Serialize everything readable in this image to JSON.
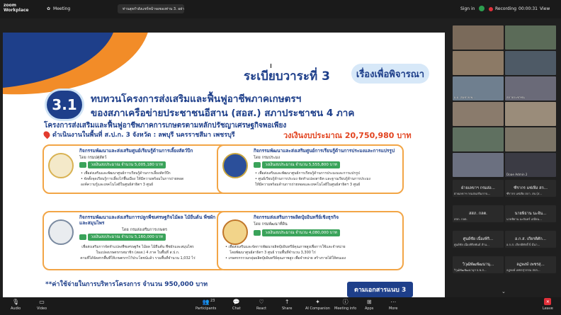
{
  "app": {
    "brand_line1": "zoom",
    "brand_line2": "Workplace",
    "meeting_label": "Meeting",
    "share_label": "ท่านสุดกำลังแชร์หน้าจอของท่าน 3. อย่า...",
    "sign_in": "Sign in",
    "recording": "Recording",
    "timer": "00:00:31",
    "view": "View"
  },
  "slide": {
    "agenda": "ระเบียบวาระที่ 3",
    "agenda_tag": "เรื่องเพื่อพิจารณา",
    "section_no": "3.1",
    "heading1": "ทบทวนโครงการส่งเสริมและฟื้นฟูอาชีพภาคเกษตรฯ",
    "heading2": "ของสภาเครือข่ายประชาชนอีสาน (สอส.) สภาประชาชน 4 ภาค",
    "project": "โครงการส่งเสริมและฟื้นฟูอาชีพภาคการเกษตรตามหลักปรัชญาเศรษฐกิจพอเพียง",
    "location": "ดำเนินงานในพื้นที่ ส.ป.ก. 3 จังหวัด : ลพบุรี นครราชสีมา เพชรบุรี",
    "budget": "วงเงินงบประมาณ 20,750,980 บาท",
    "cards": [
      {
        "title": "กิจกรรมพัฒนาและส่งเสริมศูนย์เรียนรู้ด้านการเลี้ยงสัตว์ปีก",
        "by": "โดย กรมปศุสัตว์",
        "amount": "วงเงินงบประมาณ จำนวน 5,005,180 บาท",
        "bullets": [
          "• เพื่อส่งเสริมและพัฒนาศูนย์การเรียนรู้ด้านการเลี้ยงสัตว์ปีก",
          "• จัดตั้งจุดเรียนรู้การเลี้ยงไก่พื้นเมือง ให้มีความพร้อมในการถ่ายทอด",
          "องค์ความรู้และเทคโนโลยีในศูนย์ส่าธิตฯ 3 ศูนย์"
        ]
      },
      {
        "title": "กิจกรรมพัฒนาและส่งเสริมศูนย์การเรียนรู้ด้านการประมงและการแปรรูป",
        "by": "โดย กรมประมง",
        "amount": "วงเงินงบประมาณ จำนวน 5,555,800 บาท",
        "bullets": [
          "• เพื่อส่งเสริมและพัฒนาศูนย์การเรียนรู้ด้านการประมงและการแปรรูป",
          "• ศูนย์เรียนรู้ด้านการประมง จัดทำแปลงสาธิต และฐานเรียนรู้ด้านการประมง",
          "ให้มีความพร้อมด้านการถ่ายทอดและเทคโนโลยีในศูนย์สาธิตฯ 3 ศูนย์"
        ]
      },
      {
        "title": "กิจกรรมพัฒนาและส่งเสริมการปลูกพืชเศรษฐกิจไม้ผล ไม้ยืนต้น พืชผัก และสมุนไพร",
        "by": "โดย กรมส่งเสริมการเกษตร",
        "amount": "วงเงินงบประมาณ จำนวน 5,160,000 บาท",
        "bullets": [
          "เพื่อส่งเสริมการจัดทำแปลงพืชเศรษฐกิจ ไม้ผล ไม้ยืนต้น พืชผักและสมุนไพร",
          "ในแปลงเกษตรกรสมาชิก (สอส.) 4 ภาค ในพื้นที่ ส.ป.ก.",
          "ตามที่ได้จัดสรรพื้นที่ให้เกษตรกรไว้ประโยชน์แล้ว รวมพื้นที่จำนวน 1,032 ไร่"
        ]
      },
      {
        "title": "กิจกรรมส่งเสริมการผลิตปุ๋ยอินทรีย์เชิงธุรกิจ",
        "by": "โดย กรมพัฒนาที่ดิน",
        "amount": "วงเงินงบประมาณ จำนวน 4,080,000 บาท",
        "bullets": [
          "• เพื่อส่งเสริมและจัดการพัฒนาผลิตปุ๋ยอินทรีย์คุณภาพสูงเพื่อการใช้และจำหน่าย",
          "โดยพัฒนาศูนย์สาธิตฯ 3 ศูนย์ รวมพื้นที่จำนวน 3,300 ไร่",
          "• เกษตรกรรวมกลุ่มผลิตปุ๋ยอินทรีย์คุณภาพสูง เพื่อจำหน่าย สร้างรายได้ให้ตนเอง"
        ]
      }
    ],
    "admin_cost": "**ค่าใช้จ่ายในการบริหารโครงการ  จำนวน 950,000 บาท",
    "doc_ref": "ตามเอกสารแนบ 3"
  },
  "gallery": {
    "tiles": [
      "",
      "",
      "",
      "",
      "ผ.อ. สมชาย พ...",
      "สภาประชาชน",
      "",
      "",
      "",
      "",
      "",
      "",
      "",
      "",
      "Doae Admin 2",
      "Doae Admin 2"
    ],
    "names": [
      {
        "name": "ฝ่ายเลขาฯ กรมส่ง...",
        "sub": "ฝ่ายเลขาฯ กรมส่งเสริมการเ..."
      },
      {
        "name": "ฑีรากร แซ่เฟิง สก...",
        "sub": "ฑีรากร แซ่เฟิง สภา. สบ.(ส..."
      },
      {
        "name": "สสภ. กลต.",
        "sub": "สสภ. กลต."
      },
      {
        "name": "นายพิธาน นะจัน...",
        "sub": "นายพิธาน นะจันทร์ เสมียน..."
      },
      {
        "name": "ศูนย์ชัย เนื่องพิริ...",
        "sub": "ศูนย์ชัย เนื่องพิริยพันธ์ สำน..."
      },
      {
        "name": "อ.ก.ส. เกียรติศัก...",
        "sub": "อ.ก.ส. เกียรติศักดิ์ 6 มีนา..."
      },
      {
        "name": "วิวุฒิพัฒพัฒนานุ...",
        "sub": "วิวุฒิพัฒพัฒนานุฯ จ.พ.ส..."
      },
      {
        "name": "ลฎพงษ์ เพชรสุ...",
        "sub": "ลฎพงษ์ เพชรสุวรรณ สปก..."
      }
    ]
  },
  "toolbar": {
    "audio": "Audio",
    "video": "Video",
    "participants": "Participants",
    "participants_count": "23",
    "chat": "Chat",
    "react": "React",
    "share": "Share",
    "ai": "AI Companion",
    "info": "Meeting info",
    "apps": "Apps",
    "more": "More",
    "leave": "Leave"
  }
}
